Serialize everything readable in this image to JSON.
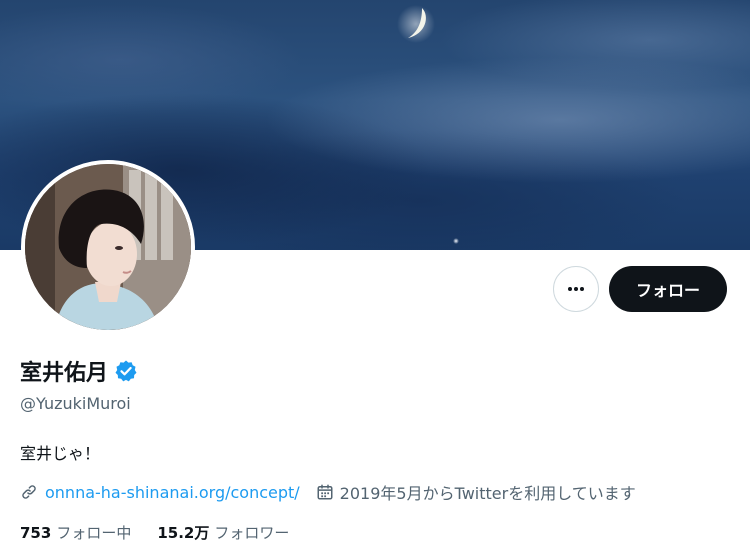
{
  "profile": {
    "display_name": "室井佑月",
    "handle": "@YuzukiMuroi",
    "bio": "室井じゃ！",
    "website": "onnna-ha-shinanai.org/concept/",
    "joined": "2019年5月からTwitterを利用しています",
    "verified": true
  },
  "actions": {
    "more_icon": "more-horizontal-icon",
    "follow_label": "フォロー"
  },
  "stats": {
    "following_count": "753",
    "following_label": "フォロー中",
    "followers_count": "15.2万",
    "followers_label": "フォロワー"
  },
  "colors": {
    "accent": "#1d9bf0",
    "text_primary": "#0f1419",
    "text_secondary": "#536471",
    "follow_button_bg": "#0f1419"
  },
  "icons": {
    "verified": "verified-badge-icon",
    "link": "link-icon",
    "calendar": "calendar-icon"
  }
}
